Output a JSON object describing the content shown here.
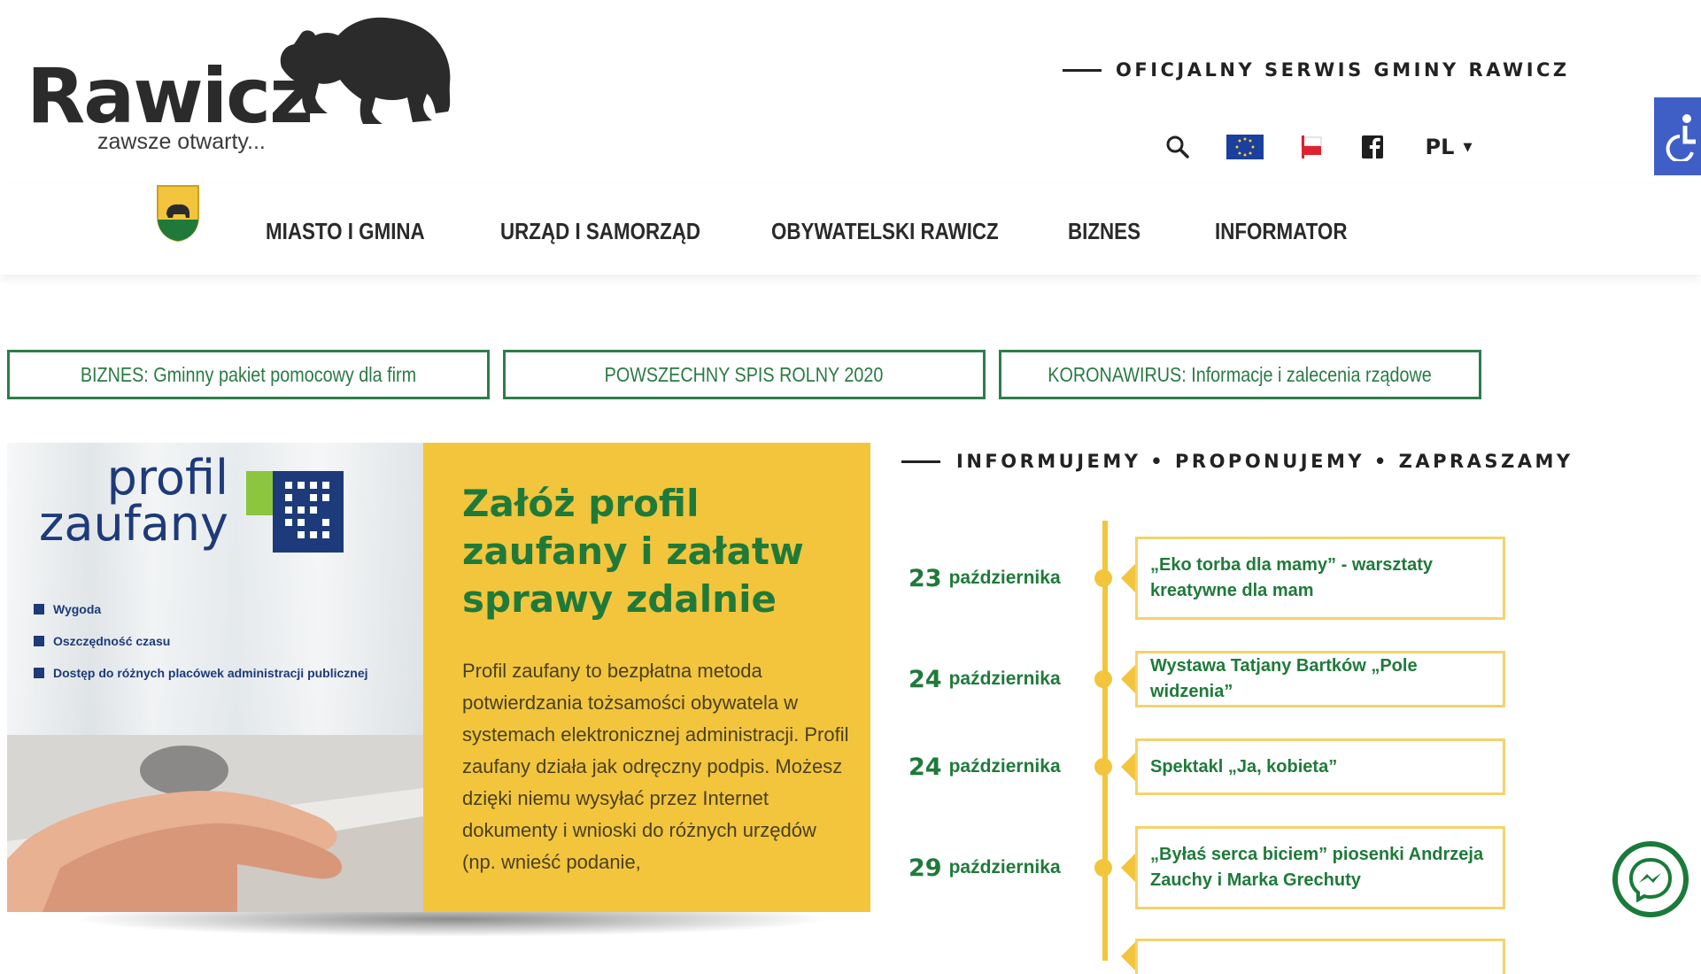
{
  "header": {
    "logo_text": "Rawicz",
    "logo_tagline": "zawsze otwarty...",
    "official_label": "OFICJALNY SERWIS GMINY RAWICZ",
    "language": "PL",
    "icons": [
      "search-icon",
      "eu-flag-icon",
      "poland-flag-icon",
      "facebook-icon",
      "accessibility-icon"
    ]
  },
  "nav": {
    "items": [
      {
        "label": "MIASTO I GMINA"
      },
      {
        "label": "URZĄD I SAMORZĄD"
      },
      {
        "label": "OBYWATELSKI RAWICZ"
      },
      {
        "label": "BIZNES"
      },
      {
        "label": "INFORMATOR"
      }
    ]
  },
  "quick_links": [
    {
      "label": "BIZNES: Gminny pakiet pomocowy dla firm"
    },
    {
      "label": "POWSZECHNY SPIS ROLNY 2020"
    },
    {
      "label": "KORONAWIRUS: Informacje i zalecenia rządowe"
    }
  ],
  "hero": {
    "image_title": "profil zaufany",
    "image_bullets": [
      "Wygoda",
      "Oszczędność czasu",
      "Dostęp do różnych placówek administracji publicznej"
    ],
    "title": "Załóż profil zaufany i załatw sprawy zdalnie",
    "text": "Profil zaufany to bezpłatna metoda potwierdzania tożsamości obywatela w systemach elektronicznej administracji. Profil zaufany działa jak odręczny podpis. Możesz dzięki niemu wysyłać przez Internet dokumenty i wnioski do różnych urzędów (np. wnieść podanie,"
  },
  "events": {
    "heading": "INFORMUJEMY • PROPONUJEMY • ZAPRASZAMY",
    "items": [
      {
        "day": "23",
        "month": "października",
        "title": "„Eko torba dla mamy” - warsztaty kreatywne dla mam"
      },
      {
        "day": "24",
        "month": "października",
        "title": "Wystawa Tatjany Bartków „Pole widzenia”"
      },
      {
        "day": "24",
        "month": "października",
        "title": "Spektakl „Ja, kobieta”"
      },
      {
        "day": "29",
        "month": "października",
        "title": "„Byłaś serca biciem” piosenki Andrzeja Zauchy i Marka Grechuty"
      }
    ]
  },
  "colors": {
    "brand_green": "#1f7a3a",
    "accent_yellow": "#f2c53d",
    "accessibility_blue": "#3f5fc6"
  }
}
